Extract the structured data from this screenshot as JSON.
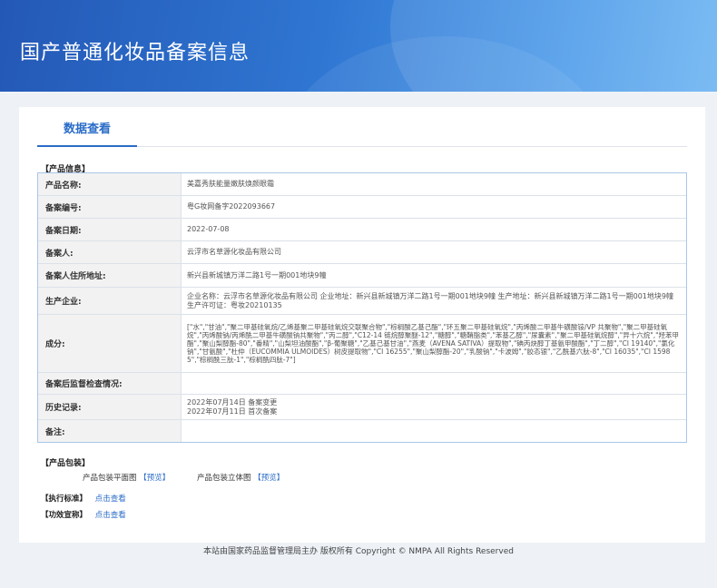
{
  "page": {
    "title": "国产普通化妆品备案信息",
    "tab": "数据查看"
  },
  "product_info": {
    "section_label": "【产品信息】",
    "rows": [
      {
        "label": "产品名称:",
        "value": "美嘉秀肤能量嫩肤焕颜眼霜"
      },
      {
        "label": "备案编号:",
        "value": "粤G妆网备字2022093667"
      },
      {
        "label": "备案日期:",
        "value": "2022-07-08"
      },
      {
        "label": "备案人:",
        "value": "云浮市名草源化妆品有限公司"
      },
      {
        "label": "备案人住所地址:",
        "value": "新兴县新城镇万洋二路1号一期001地块9幢"
      },
      {
        "label": "生产企业:",
        "value": "企业名称：云浮市名草源化妆品有限公司 企业地址：新兴县新城镇万洋二路1号一期001地块9幢 生产地址：新兴县新城镇万洋二路1号一期001地块9幢 生产许可证：粤妆20210135"
      },
      {
        "label": "成分:",
        "value": "[\"水\",\"甘油\",\"聚二甲基硅氧烷/乙烯基聚二甲基硅氧烷交联聚合物\",\"棕榈酸乙基己酯\",\"环五聚二甲基硅氧烷\",\"丙烯酸二甲基牛磺酸铵/VP 共聚物\",\"聚二甲基硅氧烷\",\"丙烯酸钠/丙烯酰二甲基牛磺酸钠共聚物\",\"丙二醇\",\"C12-14 链烷醇聚醚-12\",\"糖醇\",\"糖鞘脂类\",\"苯基乙醇\",\"尿囊素\",\"聚二甲基硅氧烷醇\",\"异十六烷\",\"羟苯甲酯\",\"聚山梨醇酯-80\",\"番精\",\"山梨坦油酸酯\",\"β-葡聚糖\",\"乙基己基甘油\",\"燕麦（AVENA SATIVA）提取物\",\"碘丙炔醇丁基氨甲酸酯\",\"丁二醇\",\"CI 19140\",\"氯化钠\",\"甘氨酸\",\"杜仲（EUCOMMIA ULMOIDES）树皮提取物\",\"CI 16255\",\"聚山梨醇酯-20\",\"乳酸钠\",\"卡波姆\",\"胶态银\",\"乙酰基六肽-8\",\"CI 16035\",\"CI 15985\",\"棕榈酰三肽-1\",\"棕榈酰四肽-7\"]"
      },
      {
        "label": "备案后监督检查情况:",
        "value": ""
      },
      {
        "label": "历史记录:",
        "value": "2022年07月14日 备案变更\n2022年07月11日 首次备案"
      },
      {
        "label": "备注:",
        "value": ""
      }
    ]
  },
  "packaging": {
    "section_label": "【产品包装】",
    "flat_label": "产品包装平面图",
    "flat_link": "【预览】",
    "solid_label": "产品包装立体图",
    "solid_link": "【预览】"
  },
  "standard": {
    "label": "【执行标准】",
    "link": "点击查看"
  },
  "efficacy": {
    "label": "【功效宣称】",
    "link": "点击查看"
  },
  "footer": "本站由国家药品监督管理局主办 版权所有 Copyright © NMPA All Rights Reserved"
}
